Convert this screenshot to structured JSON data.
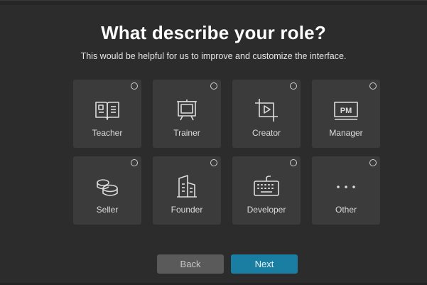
{
  "header": {
    "title": "What describe your role?",
    "subtitle": "This would be helpful for us to improve and customize the interface."
  },
  "roles": [
    {
      "label": "Teacher",
      "icon": "book-icon",
      "selected": false
    },
    {
      "label": "Trainer",
      "icon": "presentation-board-icon",
      "selected": false
    },
    {
      "label": "Creator",
      "icon": "crop-play-icon",
      "selected": false
    },
    {
      "label": "Manager",
      "icon": "pm-badge-icon",
      "selected": false
    },
    {
      "label": "Seller",
      "icon": "coins-icon",
      "selected": false
    },
    {
      "label": "Founder",
      "icon": "building-icon",
      "selected": false
    },
    {
      "label": "Developer",
      "icon": "keyboard-icon",
      "selected": false
    },
    {
      "label": "Other",
      "icon": "more-dots-icon",
      "selected": false
    }
  ],
  "pm_badge_text": "PM",
  "buttons": {
    "back_label": "Back",
    "next_label": "Next"
  },
  "colors": {
    "background": "#2c2c2c",
    "card": "#3b3b3b",
    "accent": "#1a7ea3",
    "secondary_button": "#5a5a5a"
  }
}
